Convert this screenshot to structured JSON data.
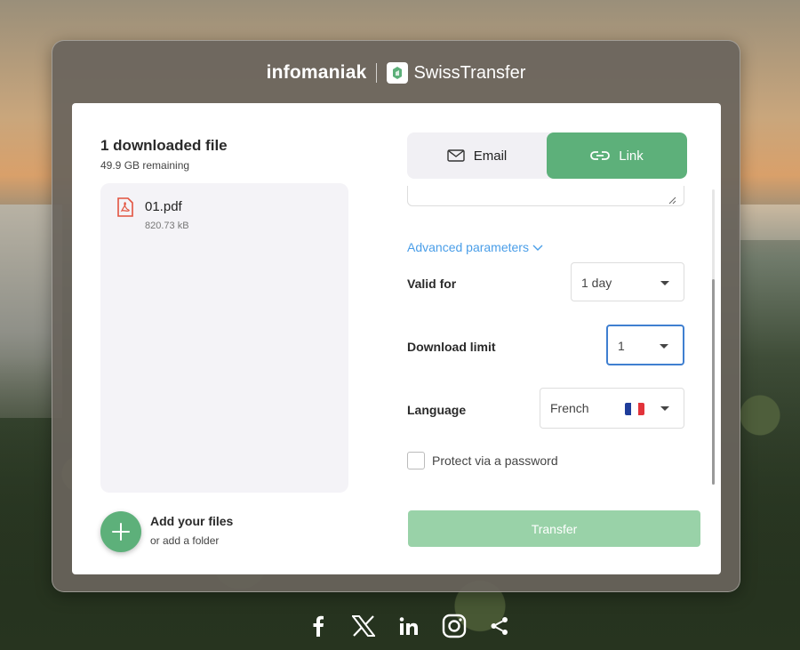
{
  "brand": {
    "company": "infomaniak",
    "product": "SwissTransfer"
  },
  "files": {
    "title": "1 downloaded file",
    "remaining": "49.9 GB remaining",
    "items": [
      {
        "name": "01.pdf",
        "size": "820.73 kB",
        "icon": "pdf-icon"
      }
    ],
    "add_title": "Add your files",
    "add_subtitle": "or add a folder"
  },
  "tabs": {
    "email": "Email",
    "link": "Link",
    "active": "link"
  },
  "options": {
    "advanced_label": "Advanced parameters",
    "valid_for": {
      "label": "Valid for",
      "value": "1 day"
    },
    "download_limit": {
      "label": "Download limit",
      "value": "1"
    },
    "language": {
      "label": "Language",
      "value": "French",
      "flag": "france-flag"
    },
    "password_label": "Protect via a password",
    "password_checked": false
  },
  "transfer_button": "Transfer",
  "social": [
    "facebook-icon",
    "x-icon",
    "linkedin-icon",
    "instagram-icon",
    "share-icon"
  ],
  "colors": {
    "accent": "#5db07a",
    "accent_disabled": "#99d2a8",
    "link": "#4a9ee8",
    "focus": "#3f7fd0"
  }
}
